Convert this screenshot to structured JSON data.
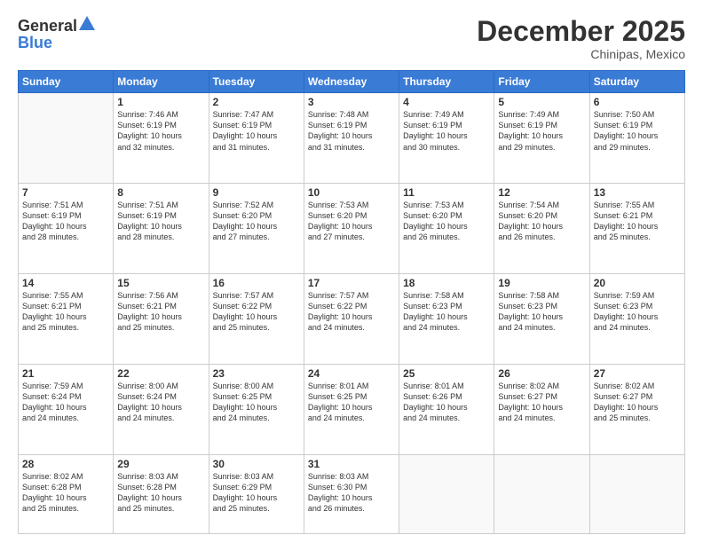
{
  "logo": {
    "general": "General",
    "blue": "Blue"
  },
  "title": "December 2025",
  "subtitle": "Chinipas, Mexico",
  "headers": [
    "Sunday",
    "Monday",
    "Tuesday",
    "Wednesday",
    "Thursday",
    "Friday",
    "Saturday"
  ],
  "weeks": [
    [
      {
        "day": "",
        "info": ""
      },
      {
        "day": "1",
        "info": "Sunrise: 7:46 AM\nSunset: 6:19 PM\nDaylight: 10 hours\nand 32 minutes."
      },
      {
        "day": "2",
        "info": "Sunrise: 7:47 AM\nSunset: 6:19 PM\nDaylight: 10 hours\nand 31 minutes."
      },
      {
        "day": "3",
        "info": "Sunrise: 7:48 AM\nSunset: 6:19 PM\nDaylight: 10 hours\nand 31 minutes."
      },
      {
        "day": "4",
        "info": "Sunrise: 7:49 AM\nSunset: 6:19 PM\nDaylight: 10 hours\nand 30 minutes."
      },
      {
        "day": "5",
        "info": "Sunrise: 7:49 AM\nSunset: 6:19 PM\nDaylight: 10 hours\nand 29 minutes."
      },
      {
        "day": "6",
        "info": "Sunrise: 7:50 AM\nSunset: 6:19 PM\nDaylight: 10 hours\nand 29 minutes."
      }
    ],
    [
      {
        "day": "7",
        "info": "Sunrise: 7:51 AM\nSunset: 6:19 PM\nDaylight: 10 hours\nand 28 minutes."
      },
      {
        "day": "8",
        "info": "Sunrise: 7:51 AM\nSunset: 6:19 PM\nDaylight: 10 hours\nand 28 minutes."
      },
      {
        "day": "9",
        "info": "Sunrise: 7:52 AM\nSunset: 6:20 PM\nDaylight: 10 hours\nand 27 minutes."
      },
      {
        "day": "10",
        "info": "Sunrise: 7:53 AM\nSunset: 6:20 PM\nDaylight: 10 hours\nand 27 minutes."
      },
      {
        "day": "11",
        "info": "Sunrise: 7:53 AM\nSunset: 6:20 PM\nDaylight: 10 hours\nand 26 minutes."
      },
      {
        "day": "12",
        "info": "Sunrise: 7:54 AM\nSunset: 6:20 PM\nDaylight: 10 hours\nand 26 minutes."
      },
      {
        "day": "13",
        "info": "Sunrise: 7:55 AM\nSunset: 6:21 PM\nDaylight: 10 hours\nand 25 minutes."
      }
    ],
    [
      {
        "day": "14",
        "info": "Sunrise: 7:55 AM\nSunset: 6:21 PM\nDaylight: 10 hours\nand 25 minutes."
      },
      {
        "day": "15",
        "info": "Sunrise: 7:56 AM\nSunset: 6:21 PM\nDaylight: 10 hours\nand 25 minutes."
      },
      {
        "day": "16",
        "info": "Sunrise: 7:57 AM\nSunset: 6:22 PM\nDaylight: 10 hours\nand 25 minutes."
      },
      {
        "day": "17",
        "info": "Sunrise: 7:57 AM\nSunset: 6:22 PM\nDaylight: 10 hours\nand 24 minutes."
      },
      {
        "day": "18",
        "info": "Sunrise: 7:58 AM\nSunset: 6:23 PM\nDaylight: 10 hours\nand 24 minutes."
      },
      {
        "day": "19",
        "info": "Sunrise: 7:58 AM\nSunset: 6:23 PM\nDaylight: 10 hours\nand 24 minutes."
      },
      {
        "day": "20",
        "info": "Sunrise: 7:59 AM\nSunset: 6:23 PM\nDaylight: 10 hours\nand 24 minutes."
      }
    ],
    [
      {
        "day": "21",
        "info": "Sunrise: 7:59 AM\nSunset: 6:24 PM\nDaylight: 10 hours\nand 24 minutes."
      },
      {
        "day": "22",
        "info": "Sunrise: 8:00 AM\nSunset: 6:24 PM\nDaylight: 10 hours\nand 24 minutes."
      },
      {
        "day": "23",
        "info": "Sunrise: 8:00 AM\nSunset: 6:25 PM\nDaylight: 10 hours\nand 24 minutes."
      },
      {
        "day": "24",
        "info": "Sunrise: 8:01 AM\nSunset: 6:25 PM\nDaylight: 10 hours\nand 24 minutes."
      },
      {
        "day": "25",
        "info": "Sunrise: 8:01 AM\nSunset: 6:26 PM\nDaylight: 10 hours\nand 24 minutes."
      },
      {
        "day": "26",
        "info": "Sunrise: 8:02 AM\nSunset: 6:27 PM\nDaylight: 10 hours\nand 24 minutes."
      },
      {
        "day": "27",
        "info": "Sunrise: 8:02 AM\nSunset: 6:27 PM\nDaylight: 10 hours\nand 25 minutes."
      }
    ],
    [
      {
        "day": "28",
        "info": "Sunrise: 8:02 AM\nSunset: 6:28 PM\nDaylight: 10 hours\nand 25 minutes."
      },
      {
        "day": "29",
        "info": "Sunrise: 8:03 AM\nSunset: 6:28 PM\nDaylight: 10 hours\nand 25 minutes."
      },
      {
        "day": "30",
        "info": "Sunrise: 8:03 AM\nSunset: 6:29 PM\nDaylight: 10 hours\nand 25 minutes."
      },
      {
        "day": "31",
        "info": "Sunrise: 8:03 AM\nSunset: 6:30 PM\nDaylight: 10 hours\nand 26 minutes."
      },
      {
        "day": "",
        "info": ""
      },
      {
        "day": "",
        "info": ""
      },
      {
        "day": "",
        "info": ""
      }
    ]
  ]
}
